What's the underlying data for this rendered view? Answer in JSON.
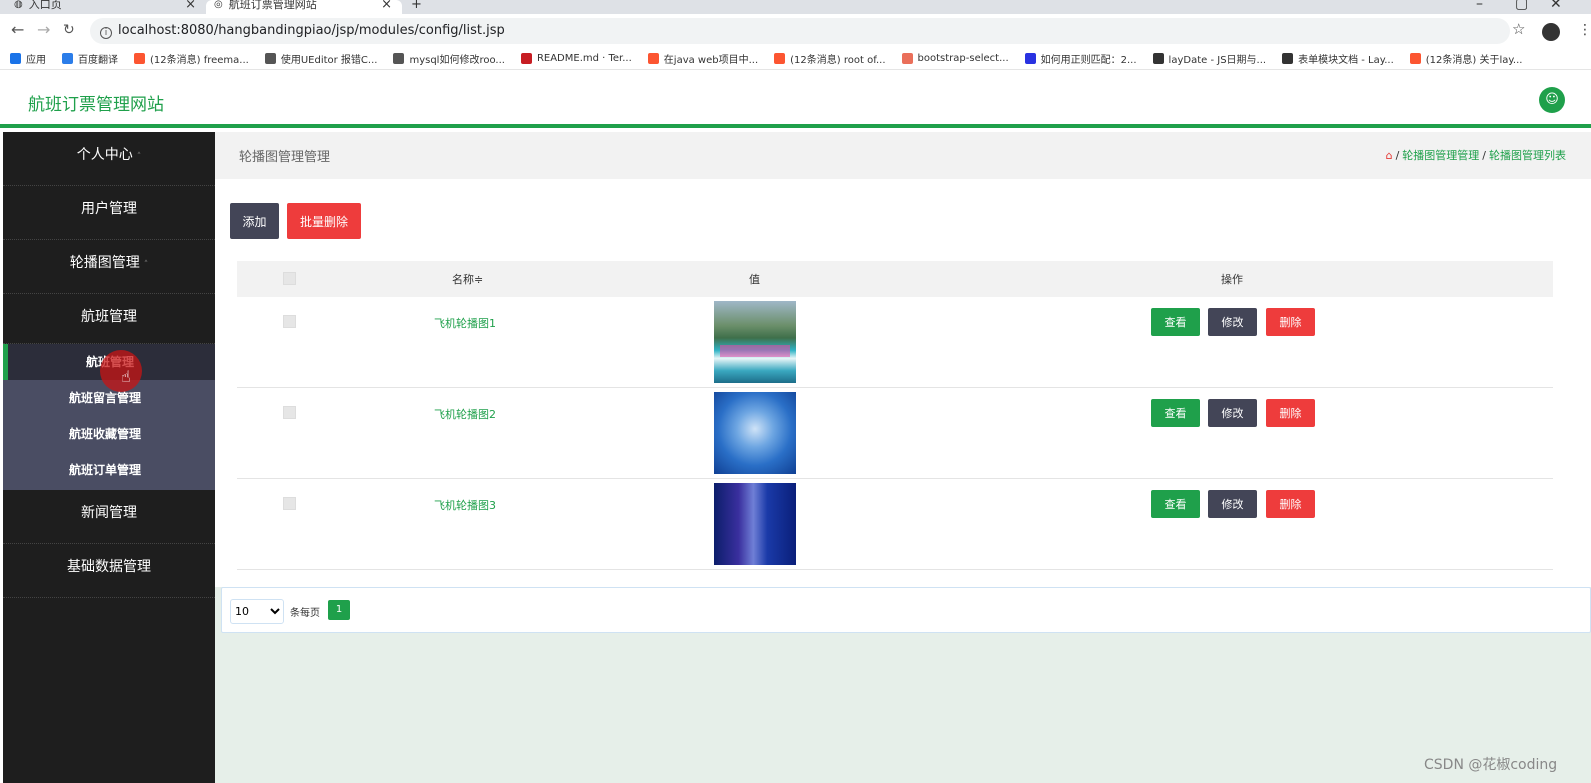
{
  "browser": {
    "tabs": [
      {
        "label": "入口页",
        "close": "×"
      },
      {
        "label": "航班订票管理网站",
        "close": "×"
      }
    ],
    "new_tab": "+",
    "url": "localhost:8080/hangbandingpiao/jsp/modules/config/list.jsp",
    "bookmarks": [
      {
        "label": "应用",
        "icon": "apps-icon",
        "color": "#1a73e8"
      },
      {
        "label": "百度翻译",
        "icon": "baidu-translate-icon",
        "color": "#2b7de9"
      },
      {
        "label": "(12条消息) freema...",
        "icon": "csdn-icon",
        "color": "#fc5531"
      },
      {
        "label": "使用UEditor 报错C...",
        "icon": "ueditor-icon",
        "color": "#555555"
      },
      {
        "label": "mysql如何修改roo...",
        "icon": "ueditor-icon",
        "color": "#555555"
      },
      {
        "label": "README.md · Ter...",
        "icon": "gitee-icon",
        "color": "#c71d23"
      },
      {
        "label": "在java web项目中...",
        "icon": "csdn-icon",
        "color": "#fc5531"
      },
      {
        "label": "(12条消息) root of...",
        "icon": "csdn-icon",
        "color": "#fc5531"
      },
      {
        "label": "bootstrap-select...",
        "icon": "jianshu-icon",
        "color": "#ea6f5a"
      },
      {
        "label": "如何用正则匹配：2...",
        "icon": "baidu-icon",
        "color": "#2932e1"
      },
      {
        "label": "layDate - JS日期与...",
        "icon": "layui-icon",
        "color": "#333333"
      },
      {
        "label": "表单模块文档 - Lay...",
        "icon": "layui-icon",
        "color": "#333333"
      },
      {
        "label": "(12条消息) 关于lay...",
        "icon": "csdn-icon",
        "color": "#fc5531"
      }
    ]
  },
  "header": {
    "site_title": "航班订票管理网站",
    "user_icon": "user-icon"
  },
  "sidebar": {
    "items": [
      {
        "label": "个人中心",
        "caret": "˄"
      },
      {
        "label": "用户管理",
        "caret": ""
      },
      {
        "label": "轮播图管理",
        "caret": "˄"
      },
      {
        "label": "航班管理",
        "caret": ""
      }
    ],
    "sub_items": [
      {
        "label": "航班管理",
        "active": true
      },
      {
        "label": "航班留言管理",
        "active": false
      },
      {
        "label": "航班收藏管理",
        "active": false
      },
      {
        "label": "航班订单管理",
        "active": false
      }
    ],
    "items_after": [
      {
        "label": "新闻管理"
      },
      {
        "label": "基础数据管理"
      }
    ]
  },
  "main": {
    "page_title": "轮播图管理管理",
    "breadcrumb": {
      "home_icon": "home-icon",
      "items": [
        "轮播图管理管理",
        "轮播图管理列表"
      ],
      "separator": "/"
    },
    "buttons": {
      "add": "添加",
      "batch_delete": "批量删除"
    },
    "table": {
      "columns": [
        "名称",
        "值",
        "操作"
      ],
      "sort_icon": "≑",
      "rows": [
        {
          "name": "飞机轮播图1",
          "thumb": "scenic-river-image"
        },
        {
          "name": "飞机轮播图2",
          "thumb": "blue-abstract-image"
        },
        {
          "name": "飞机轮播图3",
          "thumb": "dark-blue-abstract-image"
        }
      ],
      "actions": {
        "view": "查看",
        "edit": "修改",
        "delete": "删除"
      }
    },
    "pagination": {
      "page_size": "10",
      "page_size_options": [
        "10"
      ],
      "per_page_label": "条每页",
      "current_page": "1"
    }
  },
  "watermark": "CSDN @花椒coding",
  "colors": {
    "brand_green": "#1fa04b",
    "dark_button": "#434557",
    "danger": "#ee3c3c",
    "sidebar_bg": "#1e1e1e",
    "submenu_bg": "#4a4d63"
  }
}
